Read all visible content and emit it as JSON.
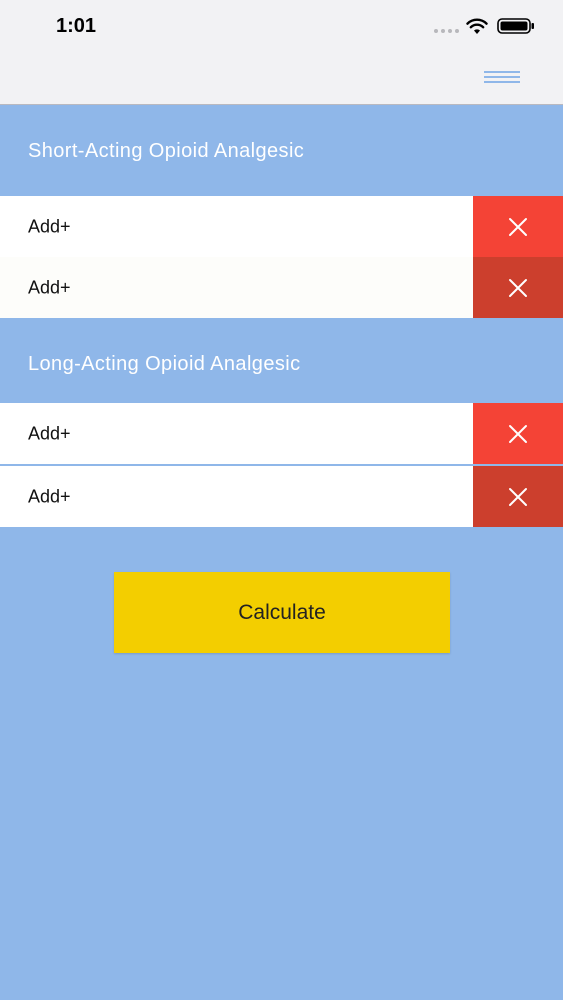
{
  "status_bar": {
    "time": "1:01",
    "icons": [
      "signal-dots-icon",
      "wifi-icon",
      "battery-icon"
    ]
  },
  "nav": {
    "menu_icon": "hamburger-menu-icon"
  },
  "sections": [
    {
      "title": "Short-Acting Opioid Analgesic",
      "rows": [
        {
          "label": "Add+"
        },
        {
          "label": "Add+"
        }
      ]
    },
    {
      "title": "Long-Acting Opioid Analgesic",
      "rows": [
        {
          "label": "Add+"
        },
        {
          "label": "Add+"
        }
      ]
    }
  ],
  "calculate_label": "Calculate",
  "colors": {
    "background": "#8fb7e9",
    "delete_red": "#f44336",
    "delete_dark_red": "#cc3f2d",
    "calculate_yellow": "#f3ce00"
  }
}
